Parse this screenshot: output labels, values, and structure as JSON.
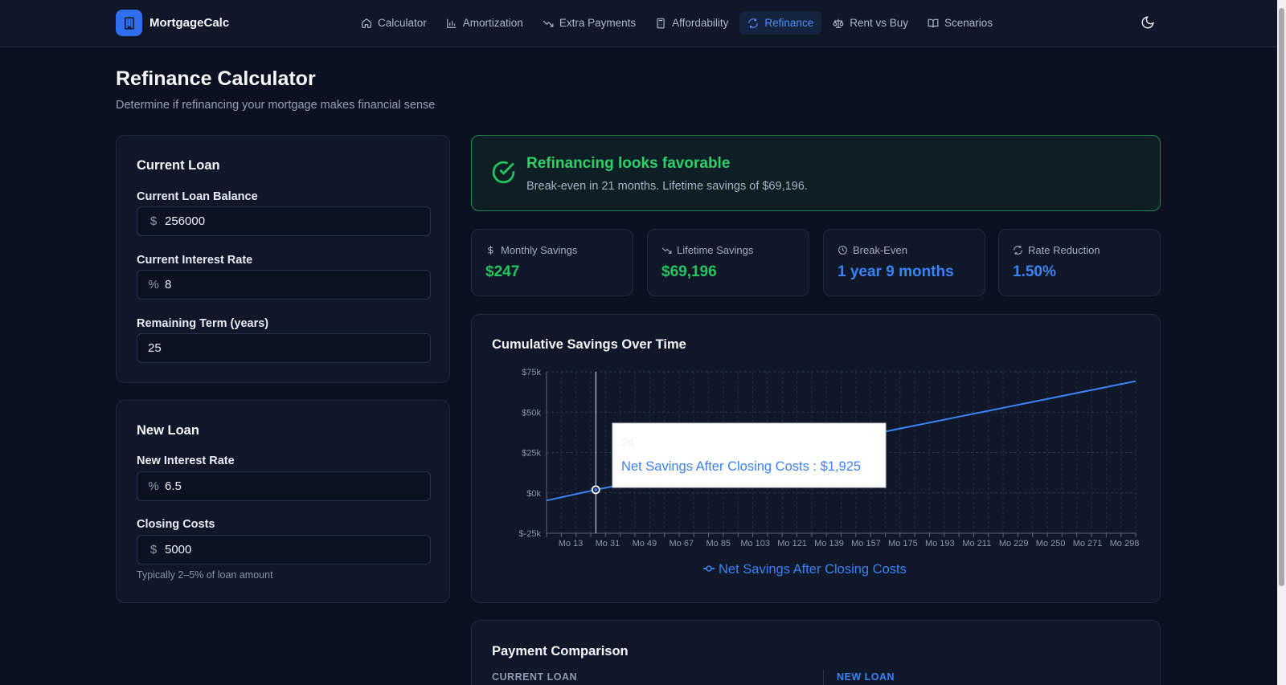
{
  "app": {
    "name": "MortgageCalc"
  },
  "nav": {
    "items": [
      {
        "label": "Calculator",
        "icon": "home-icon"
      },
      {
        "label": "Amortization",
        "icon": "bar-chart-icon"
      },
      {
        "label": "Extra Payments",
        "icon": "trending-down-icon"
      },
      {
        "label": "Affordability",
        "icon": "calculator-icon"
      },
      {
        "label": "Refinance",
        "icon": "refresh-icon"
      },
      {
        "label": "Rent vs Buy",
        "icon": "scale-icon"
      },
      {
        "label": "Scenarios",
        "icon": "book-icon"
      }
    ],
    "active": "Refinance"
  },
  "header": {
    "title": "Refinance Calculator",
    "subtitle": "Determine if refinancing your mortgage makes financial sense"
  },
  "current_loan": {
    "title": "Current Loan",
    "balance_label": "Current Loan Balance",
    "balance_prefix": "$",
    "balance_value": "256000",
    "rate_label": "Current Interest Rate",
    "rate_prefix": "%",
    "rate_value": "8",
    "term_label": "Remaining Term (years)",
    "term_value": "25"
  },
  "new_loan": {
    "title": "New Loan",
    "rate_label": "New Interest Rate",
    "rate_prefix": "%",
    "rate_value": "6.5",
    "closing_label": "Closing Costs",
    "closing_prefix": "$",
    "closing_value": "5000",
    "closing_hint": "Typically 2–5% of loan amount"
  },
  "banner": {
    "title": "Refinancing looks favorable",
    "subtitle": "Break-even in 21 months. Lifetime savings of $69,196."
  },
  "stats": [
    {
      "label": "Monthly Savings",
      "value": "$247",
      "icon": "dollar-icon",
      "color": "#22c55e"
    },
    {
      "label": "Lifetime Savings",
      "value": "$69,196",
      "icon": "trending-down-icon",
      "color": "#22c55e"
    },
    {
      "label": "Break-Even",
      "value": "1 year 9 months",
      "icon": "clock-icon",
      "color": "#3b82f6"
    },
    {
      "label": "Rate Reduction",
      "value": "1.50%",
      "icon": "refresh-icon",
      "color": "#3b82f6"
    }
  ],
  "chart_data": {
    "type": "line",
    "title": "Cumulative Savings Over Time",
    "x_ticks": [
      "Mo 13",
      "Mo 31",
      "Mo 49",
      "Mo 67",
      "Mo 85",
      "Mo 103",
      "Mo 121",
      "Mo 139",
      "Mo 157",
      "Mo 175",
      "Mo 193",
      "Mo 211",
      "Mo 229",
      "Mo 250",
      "Mo 271",
      "Mo 298"
    ],
    "y_ticks": [
      "$75k",
      "$50k",
      "$25k",
      "$0k",
      "$-25k"
    ],
    "ylim": [
      -25000,
      75000
    ],
    "xlim": [
      1,
      300
    ],
    "series": [
      {
        "name": "Net Savings After Closing Costs",
        "color": "#3b82f6",
        "x": [
          1,
          26,
          300
        ],
        "y": [
          -4750,
          1925,
          69196
        ]
      }
    ],
    "legend": "bottom",
    "grid": true,
    "tooltip": {
      "x_label": "26",
      "series": "Net Savings After Closing Costs",
      "value": "$1,925"
    }
  },
  "payment_comparison": {
    "title": "Payment Comparison",
    "current_label": "CURRENT LOAN",
    "new_label": "NEW LOAN"
  }
}
